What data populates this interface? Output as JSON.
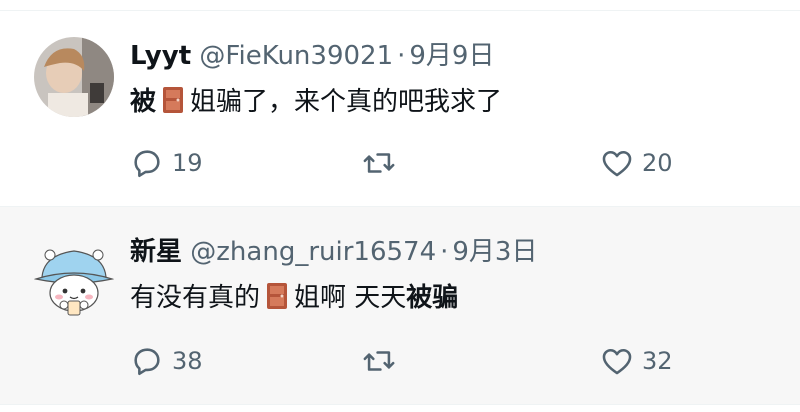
{
  "tweets": [
    {
      "name": "Lyyt",
      "handle": "@FieKun39021",
      "date": "9月9日",
      "body": {
        "bold_prefix": "被",
        "door_icon": "door-emoji-icon",
        "text_after_door": "姐骗了，来个真的吧我求了"
      },
      "replies": "19",
      "retweets": "",
      "likes": "20"
    },
    {
      "name": "新星",
      "handle": "@zhang_ruir16574",
      "date": "9月3日",
      "body": {
        "text_before_door": "有没有真的",
        "door_icon": "door-emoji-icon",
        "text_after_door": "姐啊 天天",
        "bold_suffix": "被骗"
      },
      "replies": "38",
      "retweets": "",
      "likes": "32"
    }
  ],
  "colors": {
    "text": "#0f1419",
    "secondary": "#536471",
    "divider": "#eff3f4",
    "door": "#b5553a"
  }
}
